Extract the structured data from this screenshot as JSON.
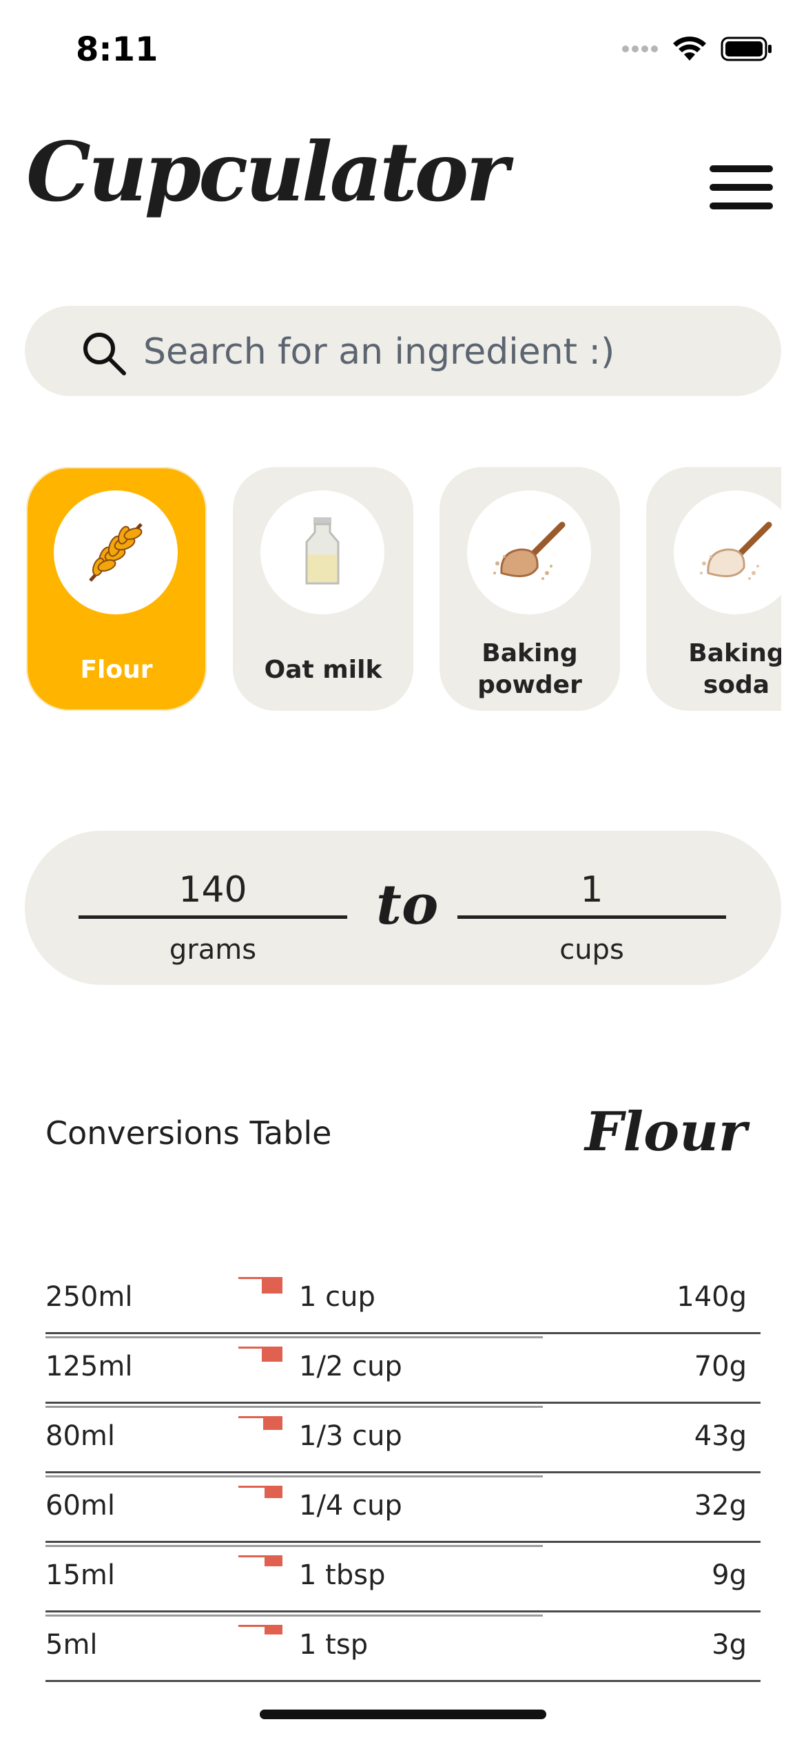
{
  "status_bar": {
    "time": "8:11",
    "icons": [
      "signal-dots-icon",
      "wifi-icon",
      "battery-icon"
    ]
  },
  "header": {
    "title": "Cupculator",
    "menu_icon": "hamburger-menu-icon"
  },
  "search": {
    "placeholder": "Search for an ingredient :)",
    "icon": "search-icon"
  },
  "ingredients": [
    {
      "label": "Flour",
      "icon": "wheat-icon",
      "active": true
    },
    {
      "label": "Oat milk",
      "icon": "milk-bottle-icon",
      "active": false
    },
    {
      "label": "Baking powder",
      "line1": "Baking",
      "line2": "powder",
      "icon": "scoop-powder-icon",
      "active": false
    },
    {
      "label": "Baking soda",
      "line1": "Baking",
      "line2": "soda",
      "icon": "scoop-soda-icon",
      "active": false
    }
  ],
  "converter": {
    "from_value": "140",
    "from_unit": "grams",
    "connector": "to",
    "to_value": "1",
    "to_unit": "cups"
  },
  "table": {
    "title": "Conversions Table",
    "ingredient": "Flour",
    "rows": [
      {
        "ml": "250ml",
        "measure": "1 cup",
        "grams": "140g"
      },
      {
        "ml": "125ml",
        "measure": "1/2 cup",
        "grams": "70g"
      },
      {
        "ml": "80ml",
        "measure": "1/3 cup",
        "grams": "43g"
      },
      {
        "ml": "60ml",
        "measure": "1/4 cup",
        "grams": "32g"
      },
      {
        "ml": "15ml",
        "measure": "1 tbsp",
        "grams": "9g"
      },
      {
        "ml": "5ml",
        "measure": "1 tsp",
        "grams": "3g"
      }
    ]
  },
  "colors": {
    "accent": "#ffb400",
    "surface": "#eeede7",
    "cup_icon": "#e0614f"
  }
}
